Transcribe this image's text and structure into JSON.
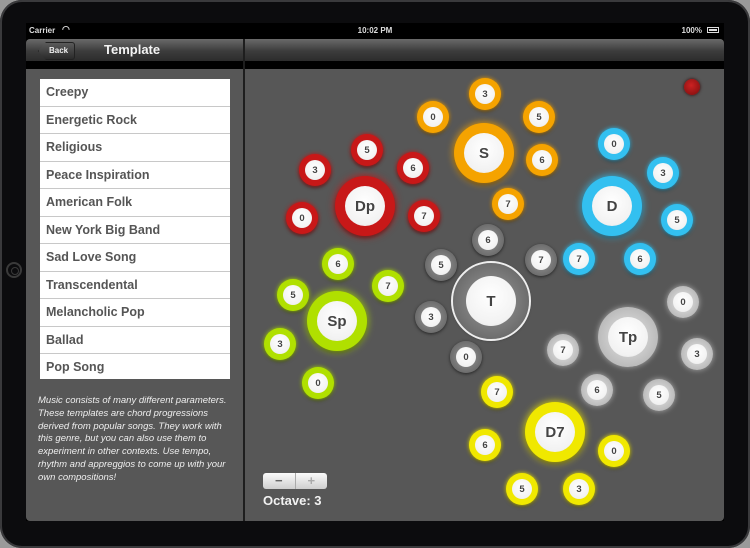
{
  "status_bar": {
    "carrier": "Carrier",
    "wifi_icon": "wifi-icon",
    "time": "10:02 PM",
    "battery_percent": "100%",
    "battery_icon": "battery-icon"
  },
  "sidebar": {
    "back_label": "Back",
    "title": "Template",
    "templates": [
      "Creepy",
      "Energetic Rock",
      "Religious",
      "Peace Inspiration",
      "American Folk",
      "New York Big Band",
      "Sad Love Song",
      "Transcendental",
      "Melancholic Pop",
      "Ballad",
      "Pop Song"
    ],
    "description": "Music consists of many different parameters. These templates are chord progressions derived from popular songs. They work with this genre, but you can also use them to experiment in other contexts. Use tempo, rhythm and appreggios to come up with your own compositions!"
  },
  "main": {
    "record_indicator": "record-indicator",
    "octave_label": "Octave: 3",
    "octave_value": 3,
    "stepper": {
      "minus": "−",
      "plus": "+"
    },
    "chord_groups": [
      {
        "name": "Dp",
        "color": "#c81818",
        "extensions": [
          "3",
          "5",
          "6",
          "0",
          "7"
        ]
      },
      {
        "name": "S",
        "color": "#f5a300",
        "extensions": [
          "0",
          "3",
          "5",
          "6",
          "7"
        ]
      },
      {
        "name": "D",
        "color": "#33c0f0",
        "extensions": [
          "0",
          "3",
          "5",
          "7",
          "6"
        ]
      },
      {
        "name": "T",
        "color": "#7a7a7a",
        "extensions": [
          "6",
          "5",
          "7",
          "3",
          "0"
        ]
      },
      {
        "name": "Sp",
        "color": "#b0e000",
        "extensions": [
          "6",
          "5",
          "7",
          "3",
          "0"
        ]
      },
      {
        "name": "Tp",
        "color": "#cfcfcf",
        "extensions": [
          "0",
          "7",
          "3",
          "6",
          "5"
        ]
      },
      {
        "name": "D7",
        "color": "#f0e800",
        "extensions": [
          "7",
          "6",
          "0",
          "5",
          "3"
        ]
      }
    ]
  }
}
